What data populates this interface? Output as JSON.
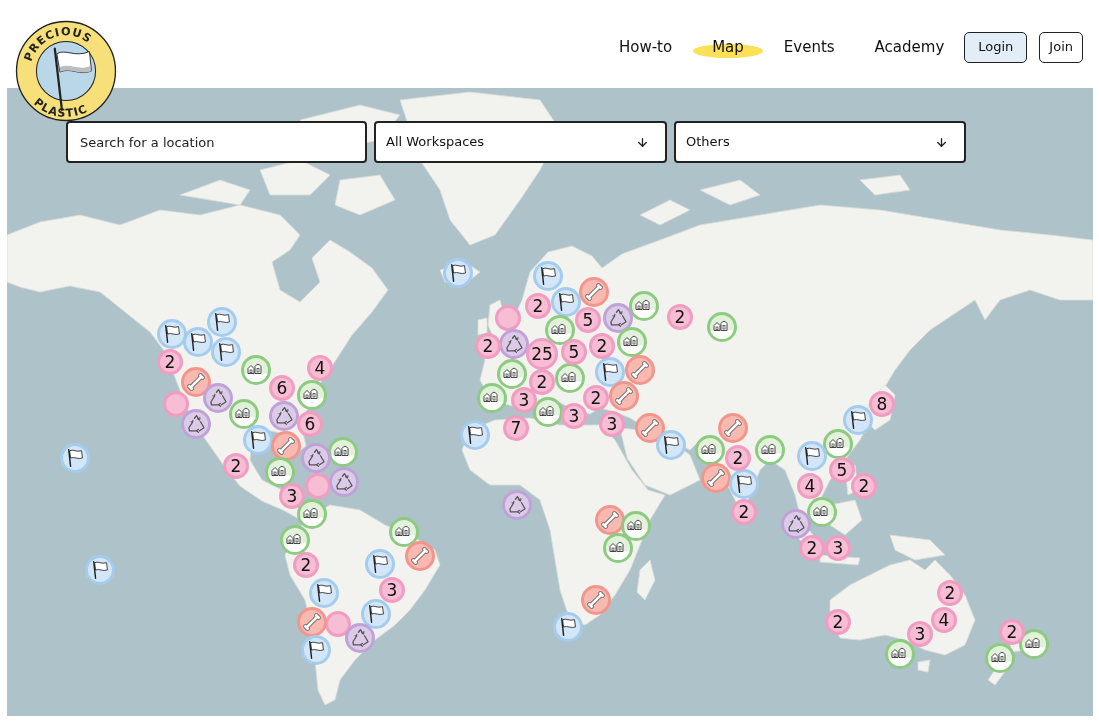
{
  "logo": {
    "top_text": "PRECIOUS",
    "bottom_text": "PLASTIC"
  },
  "nav": {
    "links": [
      {
        "label": "How-to",
        "selected": false
      },
      {
        "label": "Map",
        "selected": true
      },
      {
        "label": "Events",
        "selected": false
      },
      {
        "label": "Academy",
        "selected": false
      }
    ],
    "buttons": [
      {
        "label": "Login",
        "kind": "primary"
      },
      {
        "label": "Join",
        "kind": "secondary"
      }
    ]
  },
  "filters": {
    "search": {
      "placeholder": "Search for a location"
    },
    "dropdowns": [
      {
        "value": "All Workspaces"
      },
      {
        "value": "Others"
      }
    ]
  },
  "map": {
    "markers": [
      {
        "kind": "flag"
      },
      {
        "kind": "flag"
      },
      {
        "kind": "flag"
      },
      {
        "kind": "flag"
      },
      {
        "kind": "cluster",
        "count": "2"
      },
      {
        "kind": "cluster",
        "count": "4"
      },
      {
        "kind": "house"
      },
      {
        "kind": "wrench"
      },
      {
        "kind": "cluster",
        "count": "6"
      },
      {
        "kind": "house"
      },
      {
        "kind": "recycle"
      },
      {
        "kind": "cluster"
      },
      {
        "kind": "house"
      },
      {
        "kind": "recycle"
      },
      {
        "kind": "recycle"
      },
      {
        "kind": "cluster",
        "count": "6"
      },
      {
        "kind": "flag"
      },
      {
        "kind": "wrench"
      },
      {
        "kind": "house"
      },
      {
        "kind": "recycle"
      },
      {
        "kind": "flag"
      },
      {
        "kind": "cluster",
        "count": "2"
      },
      {
        "kind": "house"
      },
      {
        "kind": "recycle"
      },
      {
        "kind": "cluster"
      },
      {
        "kind": "cluster",
        "count": "3"
      },
      {
        "kind": "house"
      },
      {
        "kind": "house"
      },
      {
        "kind": "house"
      },
      {
        "kind": "wrench"
      },
      {
        "kind": "flag"
      },
      {
        "kind": "cluster",
        "count": "2"
      },
      {
        "kind": "flag"
      },
      {
        "kind": "cluster",
        "count": "3"
      },
      {
        "kind": "flag"
      },
      {
        "kind": "flag"
      },
      {
        "kind": "wrench"
      },
      {
        "kind": "cluster"
      },
      {
        "kind": "recycle"
      },
      {
        "kind": "flag"
      },
      {
        "kind": "flag"
      },
      {
        "kind": "flag"
      },
      {
        "kind": "wrench"
      },
      {
        "kind": "flag"
      },
      {
        "kind": "house"
      },
      {
        "kind": "cluster",
        "count": "2"
      },
      {
        "kind": "cluster",
        "count": "5"
      },
      {
        "kind": "cluster",
        "count": "2"
      },
      {
        "kind": "cluster"
      },
      {
        "kind": "recycle"
      },
      {
        "kind": "house"
      },
      {
        "kind": "house"
      },
      {
        "kind": "house"
      },
      {
        "kind": "recycle"
      },
      {
        "kind": "cluster",
        "count": "2"
      },
      {
        "kind": "cluster",
        "count": "25"
      },
      {
        "kind": "cluster",
        "count": "5"
      },
      {
        "kind": "cluster",
        "count": "2"
      },
      {
        "kind": "wrench"
      },
      {
        "kind": "flag"
      },
      {
        "kind": "house"
      },
      {
        "kind": "house"
      },
      {
        "kind": "cluster",
        "count": "2"
      },
      {
        "kind": "house"
      },
      {
        "kind": "cluster",
        "count": "3"
      },
      {
        "kind": "cluster",
        "count": "2"
      },
      {
        "kind": "wrench"
      },
      {
        "kind": "house"
      },
      {
        "kind": "cluster",
        "count": "7"
      },
      {
        "kind": "cluster",
        "count": "3"
      },
      {
        "kind": "cluster",
        "count": "3"
      },
      {
        "kind": "wrench"
      },
      {
        "kind": "flag"
      },
      {
        "kind": "flag"
      },
      {
        "kind": "recycle"
      },
      {
        "kind": "wrench"
      },
      {
        "kind": "house"
      },
      {
        "kind": "house"
      },
      {
        "kind": "wrench"
      },
      {
        "kind": "flag"
      },
      {
        "kind": "cluster",
        "count": "8"
      },
      {
        "kind": "flag"
      },
      {
        "kind": "wrench"
      },
      {
        "kind": "house"
      },
      {
        "kind": "house"
      },
      {
        "kind": "house"
      },
      {
        "kind": "flag"
      },
      {
        "kind": "cluster",
        "count": "2"
      },
      {
        "kind": "cluster",
        "count": "5"
      },
      {
        "kind": "wrench"
      },
      {
        "kind": "flag"
      },
      {
        "kind": "cluster",
        "count": "4"
      },
      {
        "kind": "cluster",
        "count": "2"
      },
      {
        "kind": "cluster",
        "count": "2"
      },
      {
        "kind": "house"
      },
      {
        "kind": "recycle"
      },
      {
        "kind": "cluster",
        "count": "2"
      },
      {
        "kind": "cluster",
        "count": "3"
      },
      {
        "kind": "cluster",
        "count": "2"
      },
      {
        "kind": "cluster",
        "count": "2"
      },
      {
        "kind": "cluster",
        "count": "3"
      },
      {
        "kind": "cluster",
        "count": "4"
      },
      {
        "kind": "cluster",
        "count": "2"
      },
      {
        "kind": "house"
      },
      {
        "kind": "house"
      },
      {
        "kind": "house"
      }
    ]
  }
}
